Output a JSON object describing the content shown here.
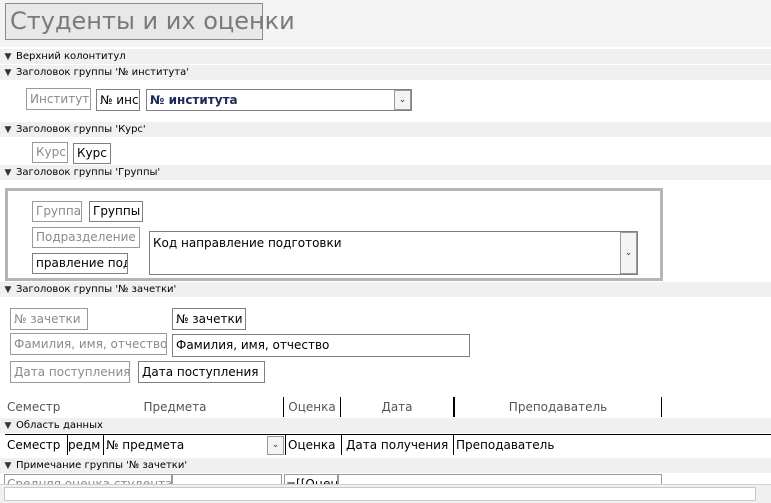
{
  "report": {
    "title": "Студенты и их оценки"
  },
  "bands": {
    "page_header": "Верхний колонтитул",
    "institute_header": "Заголовок группы '№ института'",
    "course_header": "Заголовок группы 'Курс'",
    "group_header": "Заголовок группы 'Группы'",
    "gradebook_header": "Заголовок группы '№ зачетки'",
    "detail": "Область данных",
    "gradebook_footer": "Примечание группы '№ зачетки'"
  },
  "institute": {
    "label": "Институт",
    "field_small": "№ инс",
    "combo_value": "№ института"
  },
  "course": {
    "label": "Курс",
    "field": "Курс"
  },
  "group": {
    "label": "Группа",
    "field": "Группы",
    "division_label": "Подразделение",
    "direction_label": "правление под",
    "direction_value": "Код направление подготовки"
  },
  "gradebook": {
    "number_label": "№ зачетки",
    "number_field": "№ зачетки",
    "name_label": "Фамилия, имя, отчество",
    "name_field": "Фамилия, имя, отчество",
    "admission_label": "Дата поступления",
    "admission_field": "Дата поступления"
  },
  "columns": {
    "semester": "Семестр",
    "subject": "Предмета",
    "grade": "Оценка",
    "date": "Дата",
    "teacher": "Преподаватель"
  },
  "detail_row": {
    "semester": "Семестр",
    "subject_small": "редм",
    "subject_combo": "№ предмета",
    "grade": "Оценка",
    "date": "Дата получения",
    "teacher": "Преподаватель"
  },
  "footer": {
    "avg_label": "Средняя оценка студента",
    "avg_expr": "=[[Оцен"
  }
}
